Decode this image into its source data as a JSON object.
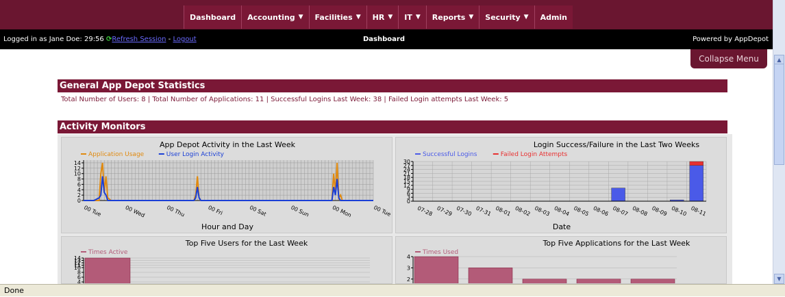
{
  "nav": {
    "items": [
      {
        "label": "Dashboard",
        "dropdown": false
      },
      {
        "label": "Accounting",
        "dropdown": true
      },
      {
        "label": "Facilities",
        "dropdown": true
      },
      {
        "label": "HR",
        "dropdown": true
      },
      {
        "label": "IT",
        "dropdown": true
      },
      {
        "label": "Reports",
        "dropdown": true
      },
      {
        "label": "Security",
        "dropdown": true
      },
      {
        "label": "Admin",
        "dropdown": false
      }
    ]
  },
  "session": {
    "logged_in_text": "Logged in as Jane Doe: 29:56",
    "refresh_label": "Refresh Session",
    "separator": " - ",
    "logout_label": "Logout",
    "page_title": "Dashboard",
    "powered_by": "Powered by AppDepot"
  },
  "collapse_menu_label": "Collapse Menu",
  "general_stats": {
    "title": "General App Depot Statistics",
    "line": "Total Number of Users: 8  |  Total Number of Applications: 11  |  Successful Logins Last Week: 38  |  Failed Login attempts Last Week: 5"
  },
  "activity": {
    "title": "Activity Monitors"
  },
  "status_bar": "Done",
  "colors": {
    "brand": "#7a1836",
    "orange": "#e08a10",
    "blue": "#1a3fd6",
    "red": "#e82020",
    "maroon_bar": "#b35b78"
  },
  "chart_data": [
    {
      "type": "line",
      "title": "App Depot Activity in the Last Week",
      "xlabel": "Hour and Day",
      "ylabel": "",
      "yticks": [
        "0",
        "2",
        "4",
        "6",
        "8",
        "10",
        "12",
        "14"
      ],
      "ylim": [
        0,
        15
      ],
      "xticks": [
        "00 Tue",
        "00 Wed",
        "00 Thu",
        "00 Fri",
        "00 Sat",
        "00 Sun",
        "00 Mon",
        "00 Tue"
      ],
      "x_hours": [
        0,
        6,
        9,
        10,
        11,
        12,
        13,
        14,
        16,
        18,
        48,
        64,
        65,
        66,
        67,
        68,
        70,
        144,
        145,
        146,
        147,
        148,
        149,
        150,
        152,
        168
      ],
      "series": [
        {
          "name": "Application Usage",
          "color": "#e08a10",
          "values": [
            0,
            0,
            0,
            10,
            14,
            3,
            9,
            1,
            0,
            0,
            0,
            0,
            2,
            9,
            1,
            0,
            0,
            0,
            10,
            3,
            14,
            1,
            2,
            0,
            0,
            0
          ]
        },
        {
          "name": "User Login Activity",
          "color": "#1a3fd6",
          "values": [
            0,
            0,
            1,
            2,
            9,
            3,
            2,
            0,
            0,
            0,
            0,
            0,
            1,
            5,
            1,
            0,
            0,
            0,
            5,
            2,
            8,
            1,
            0,
            0,
            0,
            0
          ]
        }
      ],
      "grid": true,
      "legend": "top-left"
    },
    {
      "type": "bar",
      "title": "Login Success/Failure in the Last Two Weeks",
      "xlabel": "Date",
      "ylabel": "",
      "yticks": [
        "0",
        "3",
        "6",
        "9",
        "12",
        "15",
        "18",
        "21",
        "24",
        "27",
        "30"
      ],
      "ylim": [
        0,
        30
      ],
      "categories": [
        "07-28",
        "07-29",
        "07-30",
        "07-31",
        "08-01",
        "08-02",
        "08-03",
        "08-04",
        "08-05",
        "08-06",
        "08-07",
        "08-08",
        "08-09",
        "08-10",
        "08-11"
      ],
      "series": [
        {
          "name": "Successful Logins",
          "color": "#4a5ae8",
          "values": [
            0,
            0,
            0,
            0,
            0,
            0,
            0,
            0,
            0,
            0,
            10,
            0,
            0,
            1,
            27
          ]
        },
        {
          "name": "Failed Login Attempts",
          "color": "#e83030",
          "values": [
            0,
            0,
            0,
            0,
            0,
            0,
            0,
            0,
            0,
            0,
            0,
            0,
            0,
            0,
            3
          ]
        }
      ],
      "stacked": true,
      "grid": true,
      "legend": "top-left"
    },
    {
      "type": "bar",
      "title": "Top Five Users for the Last Week",
      "xlabel": "",
      "ylabel": "",
      "yticks": [
        "2",
        "4",
        "6",
        "8",
        "10",
        "11",
        "12",
        "13",
        "14"
      ],
      "ylim": [
        0,
        14
      ],
      "categories": [],
      "series": [
        {
          "name": "Times Active",
          "color": "#b35b78",
          "values": [
            14
          ]
        }
      ],
      "legend": "top-left"
    },
    {
      "type": "bar",
      "title": "Top Five Applications for the Last Week",
      "xlabel": "",
      "ylabel": "",
      "yticks": [
        "2",
        "3",
        "4"
      ],
      "ylim": [
        1.5,
        4
      ],
      "categories": [],
      "series": [
        {
          "name": "Times Used",
          "color": "#b35b78",
          "values": [
            4,
            3,
            2,
            2,
            2
          ]
        }
      ],
      "legend": "top-left"
    }
  ]
}
